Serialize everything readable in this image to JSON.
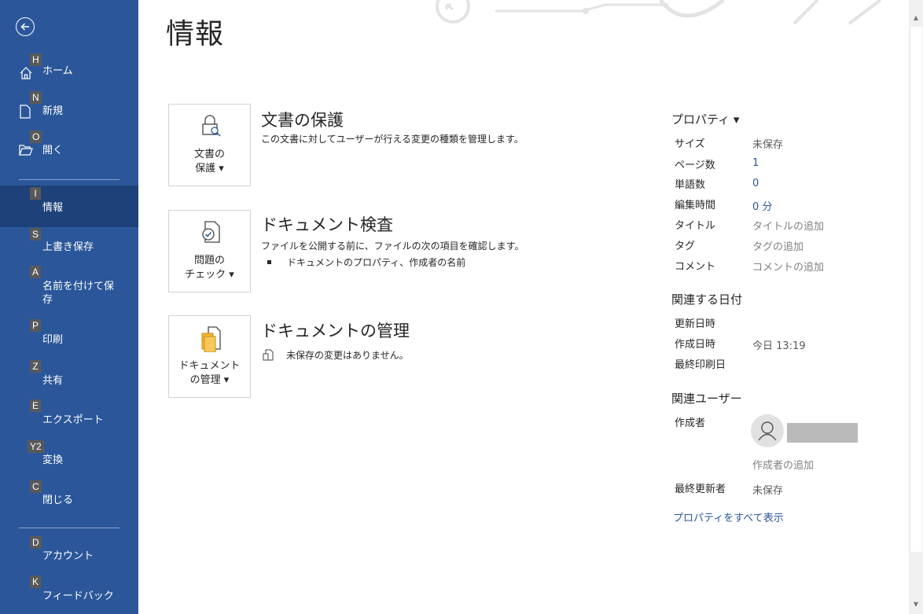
{
  "sidebar": {
    "items": [
      {
        "key": "H",
        "label": "ホーム",
        "icon": "home-icon"
      },
      {
        "key": "N",
        "label": "新規",
        "icon": "new-document-icon"
      },
      {
        "key": "O",
        "label": "開く",
        "icon": "open-folder-icon"
      },
      {
        "key": "I",
        "label": "情報"
      },
      {
        "key": "S",
        "label": "上書き保存"
      },
      {
        "key": "A",
        "label": "名前を付けて保\n存"
      },
      {
        "key": "P",
        "label": "印刷"
      },
      {
        "key": "Z",
        "label": "共有"
      },
      {
        "key": "E",
        "label": "エクスポート"
      },
      {
        "key": "Y2",
        "label": "変換"
      },
      {
        "key": "C",
        "label": "閉じる"
      },
      {
        "key": "D",
        "label": "アカウント"
      },
      {
        "key": "K",
        "label": "フィードバック"
      }
    ],
    "active": "情報",
    "accent_color": "#2b579a"
  },
  "main": {
    "title": "情報",
    "sections": [
      {
        "tile_label": "文書の\n保護 ▾",
        "title": "文書の保護",
        "description": "この文書に対してユーザーが行える変更の種類を管理します。",
        "icon": "lock-icon"
      },
      {
        "tile_label": "問題の\nチェック ▾",
        "title": "ドキュメント検査",
        "description": "ファイルを公開する前に、ファイルの次の項目を確認します。",
        "bullet": "ドキュメントのプロパティ、作成者の名前",
        "icon": "inspect-document-icon"
      },
      {
        "tile_label": "ドキュメント\nの管理 ▾",
        "title": "ドキュメントの管理",
        "description": "未保存の変更はありません。",
        "icon": "manage-document-icon"
      }
    ]
  },
  "properties": {
    "heading": "プロパティ ▾",
    "rows": [
      {
        "key": "サイズ",
        "value": "未保存"
      },
      {
        "key": "ページ数",
        "value": "1"
      },
      {
        "key": "単語数",
        "value": "0"
      },
      {
        "key": "編集時間",
        "value": "0 分"
      },
      {
        "key": "タイトル",
        "value": "タイトルの追加"
      },
      {
        "key": "タグ",
        "value": "タグの追加"
      },
      {
        "key": "コメント",
        "value": "コメントの追加"
      }
    ],
    "dates_heading": "関連する日付",
    "dates": [
      {
        "key": "更新日時",
        "value": ""
      },
      {
        "key": "作成日時",
        "value": "今日 13:19"
      },
      {
        "key": "最終印刷日",
        "value": ""
      }
    ],
    "people_heading": "関連ユーザー",
    "author_key": "作成者",
    "add_author": "作成者の追加",
    "last_modified_key": "最終更新者",
    "last_modified_value": "未保存",
    "show_all": "プロパティをすべて表示"
  }
}
